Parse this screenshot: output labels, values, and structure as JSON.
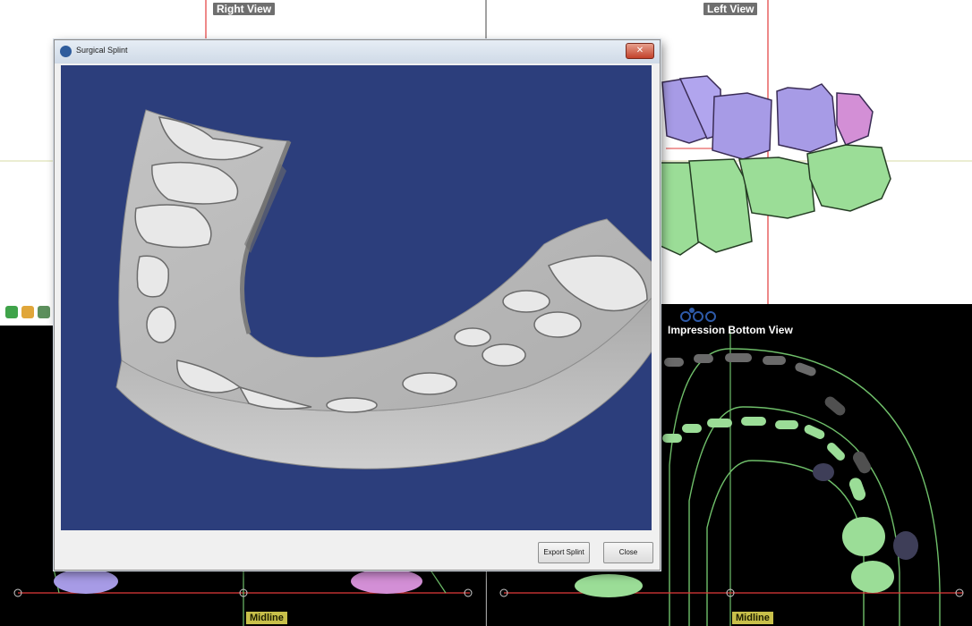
{
  "views": {
    "right_view_label": "Right View",
    "left_view_label": "Left View",
    "impression_bottom_view_label": "Impression Bottom View",
    "midline_label_left": "Midline",
    "midline_label_right": "Midline"
  },
  "dialog": {
    "title": "Surgical Splint",
    "close_glyph": "✕",
    "buttons": {
      "export_label": "Export Splint",
      "close_label": "Close"
    }
  },
  "colors": {
    "viewport_background": "#2c3e7c",
    "splint_gray": "#b9b9b9",
    "upper_teeth_purple": "#a79be6",
    "lower_teeth_green": "#9bdd97",
    "guide_lines": "#6fbf6a",
    "crosshair_red": "#e23b3b"
  },
  "icons": [
    "surgical-splint-app-icon",
    "zoom-in-icon",
    "zoom-out-icon",
    "fit-view-icon",
    "view-mode-icon"
  ]
}
